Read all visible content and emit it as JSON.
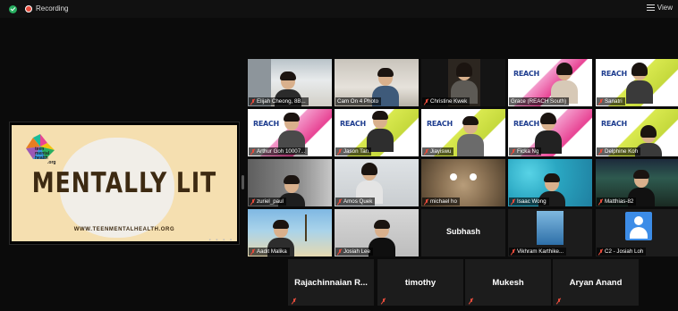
{
  "topbar": {
    "recording_label": "Recording",
    "view_label": "View"
  },
  "share": {
    "slide_title": "MENTALLY LIT",
    "slide_url": "WWW.TEENMENTALHEALTH.ORG",
    "logo_text": "teen mental health .org"
  },
  "participants": [
    {
      "name": "Elijah Cheong, 8B...",
      "muted": true
    },
    {
      "name": "Cam On 4 Photo",
      "muted": false
    },
    {
      "name": "Christine Kwek",
      "muted": true
    },
    {
      "name": "Grace (REACH South)",
      "muted": false
    },
    {
      "name": "Sanatri",
      "muted": true
    },
    {
      "name": "Arthur Goh 10007...",
      "muted": true
    },
    {
      "name": "Jason Tan",
      "muted": true
    },
    {
      "name": "Jiayiswu",
      "muted": true
    },
    {
      "name": "Ficka Ng",
      "muted": true
    },
    {
      "name": "Delphine Koh",
      "muted": true
    },
    {
      "name": "zuriel_paul",
      "muted": true
    },
    {
      "name": "Amos Quek",
      "muted": true
    },
    {
      "name": "michael ho",
      "muted": true
    },
    {
      "name": "Isaac Wong",
      "muted": true
    },
    {
      "name": "Matthias-82",
      "muted": true
    },
    {
      "name": "Aadit Malika",
      "muted": true
    },
    {
      "name": "Josiah Lee",
      "muted": true
    },
    {
      "name": "Subhash",
      "muted": false
    },
    {
      "name": "Vikhram Karthike...",
      "muted": true
    },
    {
      "name": "C2 - Josiah Loh",
      "muted": true
    }
  ],
  "bottom_row": [
    {
      "name": "Rajachinnaian R..."
    },
    {
      "name": "timothy"
    },
    {
      "name": "Mukesh"
    },
    {
      "name": "Aryan Anand"
    }
  ],
  "reach_logo_text": "REACH",
  "colors": {
    "recording": "#e74c3c",
    "secure": "#27ae60",
    "active_speaker": "#e8e85a",
    "slide_bg": "#f5dfb0",
    "slide_text": "#3d2a12",
    "avatar": "#3c8ce7"
  }
}
